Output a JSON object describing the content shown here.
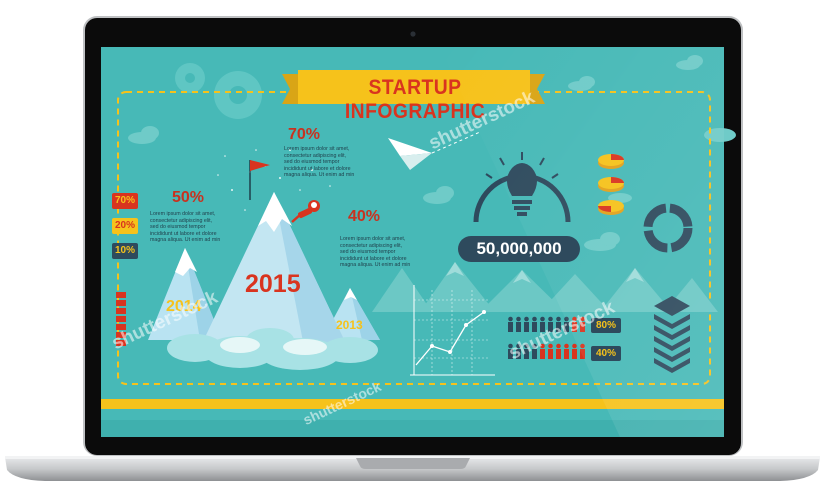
{
  "banner": {
    "title": "STARTUP INFOGRAPHIC"
  },
  "mountains": {
    "peak_center": {
      "percent": "70%",
      "year": "2015"
    },
    "peak_left": {
      "percent": "50%",
      "year": "2014"
    },
    "peak_right": {
      "percent": "40%",
      "year": "2013"
    }
  },
  "lorem": {
    "line1": "Lorem ipsum dolor sit amet,",
    "line2": "consectetur adipiscing elit,",
    "line3": "sed do eiusmod tempor",
    "line4": "incididunt ut labore et dolore",
    "line5": "magna aliqua. Ut enim ad min"
  },
  "legend_tags": [
    "70%",
    "20%",
    "10%"
  ],
  "metric": {
    "value": "50,000,000"
  },
  "people_stats": {
    "row1": "80%",
    "row2": "40%"
  },
  "watermark": "shutterstock",
  "colors": {
    "screen_bg": "#47b9b7",
    "ribbon": "#f6c21b",
    "accent_red": "#d9341f",
    "navy": "#2e4a5d",
    "bezel": "#0b0b0b",
    "aluminium": "#d2d4d6"
  }
}
